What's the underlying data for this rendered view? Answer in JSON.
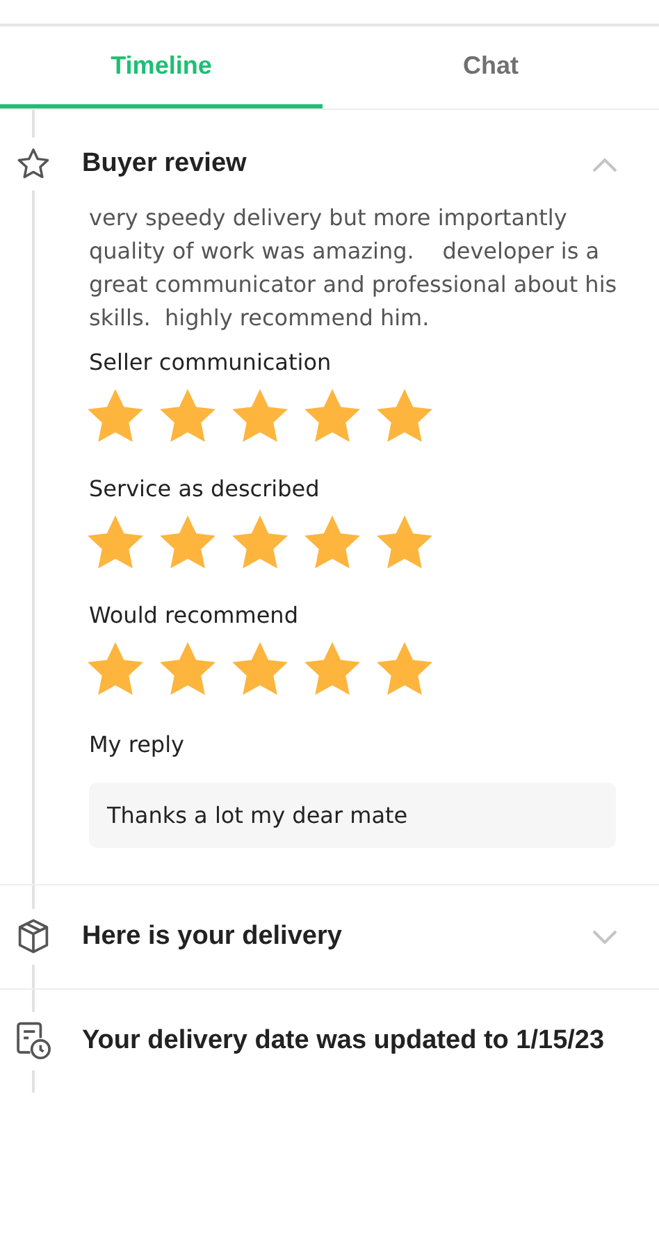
{
  "tabs": [
    {
      "label": "Timeline",
      "selected": true
    },
    {
      "label": "Chat",
      "selected": false
    }
  ],
  "events": [
    {
      "kind": "review",
      "title": "Buyer review",
      "expanded": true,
      "text": "very speedy delivery but more importantly quality of work was amazing.    developer is a great communicator and professional about his skills.  highly recommend him.",
      "ratings": [
        {
          "label": "Seller communication",
          "stars": 5
        },
        {
          "label": "Service as described",
          "stars": 5
        },
        {
          "label": "Would recommend",
          "stars": 5
        }
      ],
      "reply_label": "My reply",
      "reply": "Thanks a lot my dear mate"
    },
    {
      "kind": "delivery",
      "title": "Here is your delivery",
      "expanded": false
    },
    {
      "kind": "date",
      "title": "Your delivery date was updated to 1/15/23"
    }
  ]
}
